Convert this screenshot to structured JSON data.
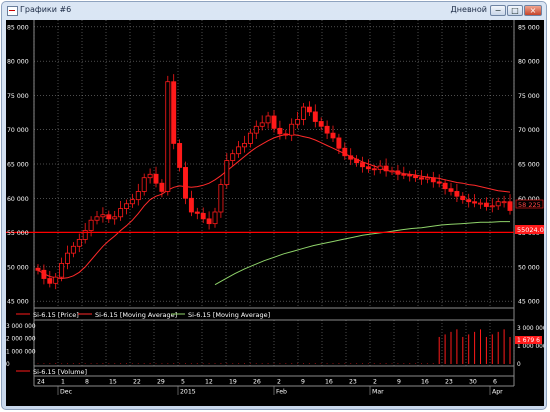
{
  "window": {
    "title": "Графики #6",
    "period": "Дневной",
    "buttons": {
      "minimize": "−",
      "maximize": "□",
      "close": "×"
    }
  },
  "colors": {
    "background": "#000000",
    "candle": "#ff1a1a",
    "ma_red": "#ff2a2a",
    "ma_green": "#8fd36a",
    "level": "#ff0000",
    "volume": "#ff1a1a",
    "grid": "#9a9a9a",
    "text": "#ffffff"
  },
  "price_axis": {
    "ticks": [
      "85 000",
      "80 000",
      "75 000",
      "70 000",
      "65 000",
      "60 000",
      "55 000",
      "50 000",
      "45 000"
    ],
    "last_price_label": "58 225",
    "level_label": "55024.0"
  },
  "legend": {
    "items": [
      {
        "label": "Si-6.15 [Price]",
        "color": "#ff1a1a"
      },
      {
        "label": "Si-6.15 [Moving Average]",
        "color": "#ff2a2a"
      },
      {
        "label": "Si-6.15 [Moving Average]",
        "color": "#8fd36a"
      }
    ],
    "volume_label": "Si-6.15 [Volume]"
  },
  "volume_axis": {
    "left_ticks": [
      "3 000 000",
      "2 000 000",
      "1 000 000",
      "0"
    ],
    "right_ticks": [
      "3 000 000",
      "1 000 000",
      "0"
    ],
    "current_label": "1 679 6"
  },
  "date_axis": {
    "days": [
      "24",
      "1",
      "8",
      "15",
      "22",
      "29",
      "5",
      "12",
      "19",
      "26",
      "2",
      "9",
      "16",
      "23",
      "2",
      "9",
      "16",
      "23",
      "30",
      "6"
    ],
    "months": [
      "Dec",
      "2015",
      "Feb",
      "Mar",
      "Apr"
    ]
  },
  "chart_data": {
    "type": "candlestick",
    "instrument": "Si-6.15",
    "ylim": [
      44000,
      86000
    ],
    "level": 55024.0,
    "last_price": 58225,
    "close": [
      49500,
      48300,
      47600,
      48500,
      50500,
      52000,
      53000,
      54000,
      55300,
      56800,
      57300,
      57600,
      57000,
      57300,
      58500,
      59200,
      59800,
      61000,
      63000,
      63500,
      62200,
      61000,
      77000,
      68000,
      64500,
      60000,
      58000,
      57800,
      57000,
      56300,
      58000,
      62000,
      65500,
      66500,
      67500,
      68000,
      69500,
      70500,
      71000,
      72000,
      70200,
      69400,
      69200,
      70800,
      71500,
      73300,
      72600,
      71200,
      70500,
      69500,
      68800,
      67300,
      66200,
      65700,
      65200,
      64600,
      64300,
      64200,
      64700,
      64000,
      64000,
      63500,
      63400,
      63300,
      63000,
      62800,
      63000,
      62400,
      62200,
      61400,
      61000,
      60300,
      59800,
      59500,
      59300,
      59300,
      58800,
      58900,
      59500,
      59500,
      58225
    ],
    "ma_red": [
      49500,
      49000,
      48600,
      48400,
      48300,
      48400,
      48700,
      49200,
      50000,
      51000,
      52000,
      53000,
      53800,
      54500,
      55300,
      56000,
      56800,
      57800,
      58900,
      59800,
      60300,
      60600,
      61200,
      61600,
      61800,
      61700,
      61600,
      61700,
      61900,
      62200,
      62700,
      63300,
      64000,
      64700,
      65400,
      66100,
      66800,
      67400,
      67900,
      68400,
      68800,
      69100,
      69300,
      69300,
      69200,
      69000,
      68800,
      68500,
      68100,
      67700,
      67300,
      66900,
      66500,
      66100,
      65700,
      65300,
      65000,
      64700,
      64400,
      64100,
      63900,
      63800,
      63600,
      63500,
      63400,
      63200,
      63100,
      63000,
      62900,
      62700,
      62500,
      62300,
      62200,
      62000,
      61900,
      61700,
      61500,
      61300,
      61100,
      61000,
      60900
    ],
    "ma_green_x_start_index": 30,
    "ma_green": [
      47400,
      48200,
      49000,
      49700,
      50300,
      50900,
      51400,
      51900,
      52300,
      52700,
      53100,
      53400,
      53700,
      54000,
      54300,
      54600,
      54800,
      55000,
      55200,
      55400,
      55600,
      55700,
      55900,
      56100,
      56200,
      56300,
      56400,
      56500,
      56500,
      56600,
      56600
    ],
    "volume": {
      "ylim": [
        0,
        3300000
      ],
      "bars": [
        {
          "from_index": 0,
          "to_index": 67,
          "value": 40000
        },
        {
          "from_index": 68,
          "to_index": 80,
          "value": 2500000
        }
      ]
    }
  }
}
